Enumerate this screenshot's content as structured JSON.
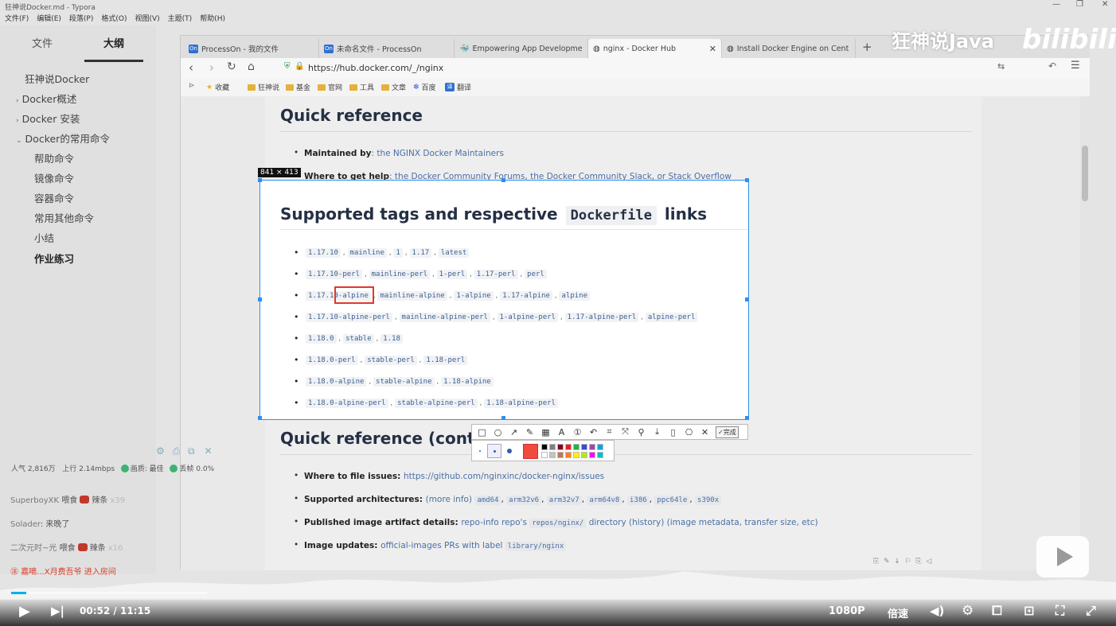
{
  "typora": {
    "title": "狂神说Docker.md - Typora",
    "menu": [
      "文件(F)",
      "编辑(E)",
      "段落(P)",
      "格式(O)",
      "视图(V)",
      "主题(T)",
      "帮助(H)"
    ]
  },
  "sidebar": {
    "tabs": [
      "文件",
      "大纲"
    ],
    "outline": [
      {
        "label": "狂神说Docker",
        "indent": 0,
        "caret": ""
      },
      {
        "label": "Docker概述",
        "indent": 0,
        "caret": "›"
      },
      {
        "label": "Docker 安装",
        "indent": 0,
        "caret": "›"
      },
      {
        "label": "Docker的常用命令",
        "indent": 0,
        "caret": "⌄"
      },
      {
        "label": "帮助命令",
        "indent": 1,
        "caret": ""
      },
      {
        "label": "镜像命令",
        "indent": 1,
        "caret": ""
      },
      {
        "label": "容器命令",
        "indent": 1,
        "caret": ""
      },
      {
        "label": "常用其他命令",
        "indent": 1,
        "caret": ""
      },
      {
        "label": "小结",
        "indent": 1,
        "caret": ""
      },
      {
        "label": "作业练习",
        "indent": 1,
        "caret": ""
      }
    ]
  },
  "browser": {
    "tabs": [
      {
        "label": "ProcessOn - 我的文件",
        "icon": "On"
      },
      {
        "label": "未命名文件 - ProcessOn",
        "icon": "On"
      },
      {
        "label": "Empowering App Developme",
        "icon": "🐳"
      },
      {
        "label": "nginx - Docker Hub",
        "icon": "◍"
      },
      {
        "label": "Install Docker Engine on Cent",
        "icon": "◍"
      }
    ],
    "url": "https://hub.docker.com/_/nginx",
    "bookmarks": [
      "收藏",
      "狂神说",
      "基金",
      "官网",
      "工具",
      "文章",
      "百度",
      "翻译"
    ]
  },
  "page": {
    "heading1": "Quick reference",
    "maintained_label": "Maintained by",
    "maintained_value": ": the NGINX Docker Maintainers",
    "help_label": "Where to get help",
    "help_value": ": the Docker Community Forums, the Docker Community Slack, or Stack Overflow",
    "heading2": "Quick reference (cont.)",
    "issues_label": "Where to file issues",
    "issues_value": "https://github.com/nginxinc/docker-nginx/issues",
    "arch_label": "Supported architectures",
    "arch_pre": "(more info)",
    "arch_tags": [
      "amd64",
      "arm32v6",
      "arm32v7",
      "arm64v8",
      "i386",
      "ppc64le",
      "s390x"
    ],
    "published_label": "Published image artifact details",
    "published_value": "repo-info repo's",
    "published_tag": "repos/nginx/",
    "published_tail": "directory (history) (image metadata, transfer size, etc)",
    "updates_label": "Image updates",
    "updates_value": "official-images PRs with label",
    "updates_tag": "library/nginx"
  },
  "snip": {
    "size": "841 × 413",
    "title_pre": "Supported tags and respective",
    "title_code": "Dockerfile",
    "title_post": "links",
    "rows": [
      [
        "1.17.10",
        "mainline",
        "1",
        "1.17",
        "latest"
      ],
      [
        "1.17.10-perl",
        "mainline-perl",
        "1-perl",
        "1.17-perl",
        "perl"
      ],
      [
        "1.17.10-alpine",
        "mainline-alpine",
        "1-alpine",
        "1.17-alpine",
        "alpine"
      ],
      [
        "1.17.10-alpine-perl",
        "mainline-alpine-perl",
        "1-alpine-perl",
        "1.17-alpine-perl",
        "alpine-perl"
      ],
      [
        "1.18.0",
        "stable",
        "1.18"
      ],
      [
        "1.18.0-perl",
        "stable-perl",
        "1.18-perl"
      ],
      [
        "1.18.0-alpine",
        "stable-alpine",
        "1.18-alpine"
      ],
      [
        "1.18.0-alpine-perl",
        "stable-alpine-perl",
        "1.18-alpine-perl"
      ]
    ],
    "done_label": "完成",
    "current_color": "#f04b3e",
    "palette": [
      "#000000",
      "#7f7f7f",
      "#880015",
      "#ed1c24",
      "#22b14c",
      "#3f48cc",
      "#a349a4",
      "#00a2e8",
      "#ffffff",
      "#c3c3c3",
      "#b97a57",
      "#ff7f27",
      "#fff200",
      "#b5e61d",
      "#ff00ff",
      "#00bfbf"
    ]
  },
  "bili": {
    "brand": "狂神说Java",
    "logo": "bilibili",
    "stats": {
      "popularity": "人气 2,816万",
      "upload": "上行 2.14mbps",
      "quality": "画质: 最佳",
      "dropped": "丢帧 0.0%"
    },
    "danmu": [
      {
        "user": "SuperboyXK",
        "act": "喂食",
        "gift": "辣条",
        "count": "x39"
      },
      {
        "user": "Solader",
        "act": "来晚了",
        "gift": "",
        "count": ""
      },
      {
        "user": "二次元时~光",
        "act": "喂食",
        "gift": "辣条",
        "count": "x16"
      }
    ],
    "notice": "嘉嘀...X月费吾爷 进入房间",
    "time_current": "00:52",
    "time_sep": "/",
    "time_total": "11:15",
    "progress": 0.077,
    "quality": "1080P",
    "speed": "倍速"
  }
}
